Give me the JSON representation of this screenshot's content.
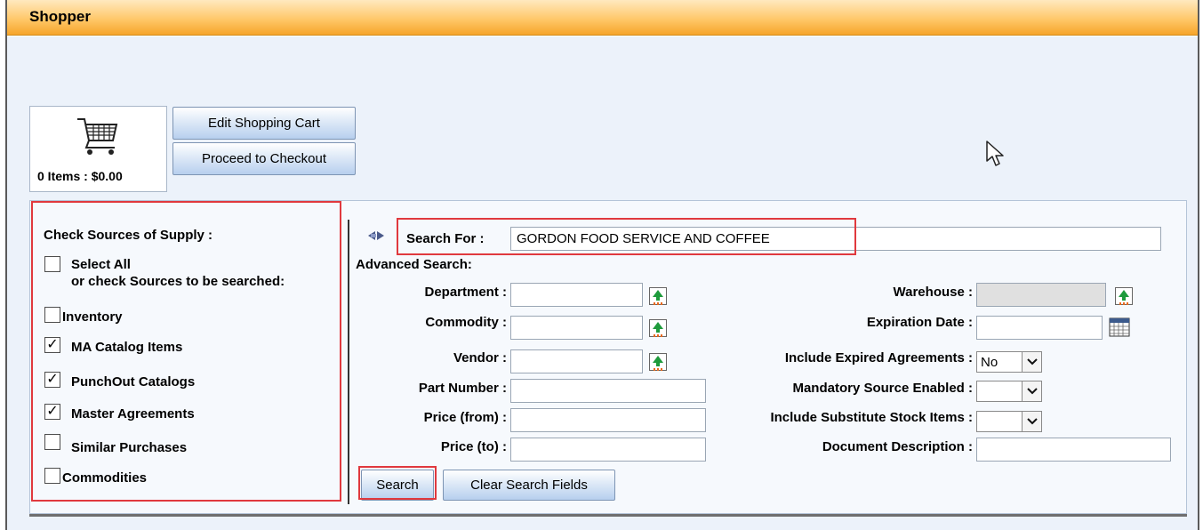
{
  "window": {
    "title": "Shopper"
  },
  "cart": {
    "summary": "0 Items : $0.00",
    "edit_label": "Edit Shopping Cart",
    "checkout_label": "Proceed to Checkout"
  },
  "sources": {
    "heading": "Check Sources of Supply :",
    "select_all_label": "Select All",
    "select_all_hint": "or check Sources to be searched:",
    "items": [
      {
        "label": "Inventory",
        "checked": false
      },
      {
        "label": "MA Catalog Items",
        "checked": true
      },
      {
        "label": "PunchOut Catalogs",
        "checked": true
      },
      {
        "label": "Master Agreements",
        "checked": true
      },
      {
        "label": "Similar Purchases",
        "checked": false
      },
      {
        "label": "Commodities",
        "checked": false
      }
    ]
  },
  "search": {
    "search_for_label": "Search For :",
    "search_for_value": "GORDON FOOD SERVICE AND COFFEE",
    "advanced_label": "Advanced Search:",
    "left_fields": [
      {
        "label": "Department :",
        "value": ""
      },
      {
        "label": "Commodity :",
        "value": ""
      },
      {
        "label": "Vendor :",
        "value": ""
      },
      {
        "label": "Part Number :",
        "value": ""
      },
      {
        "label": "Price (from) :",
        "value": ""
      },
      {
        "label": "Price (to) :",
        "value": ""
      }
    ],
    "right_fields": [
      {
        "label": "Warehouse :",
        "value": ""
      },
      {
        "label": "Expiration Date :",
        "value": ""
      },
      {
        "label": "Include Expired Agreements :",
        "value": "No"
      },
      {
        "label": "Mandatory Source Enabled :",
        "value": ""
      },
      {
        "label": "Include Substitute Stock Items :",
        "value": ""
      },
      {
        "label": "Document Description :",
        "value": ""
      }
    ],
    "search_button": "Search",
    "clear_button": "Clear Search Fields"
  },
  "icons": {
    "cart": "shopping-cart-icon",
    "lookup": "lookup-upload-icon",
    "calendar": "calendar-icon",
    "toggle": "expand-collapse-arrows-icon",
    "dropdown": "chevron-down-icon",
    "checkmark": "checkmark-glyph",
    "pointer": "mouse-cursor"
  },
  "colors": {
    "title_gradient_end": "#f6a52a",
    "highlight": "#e0393e",
    "panel_bg": "#ecf2fa"
  }
}
